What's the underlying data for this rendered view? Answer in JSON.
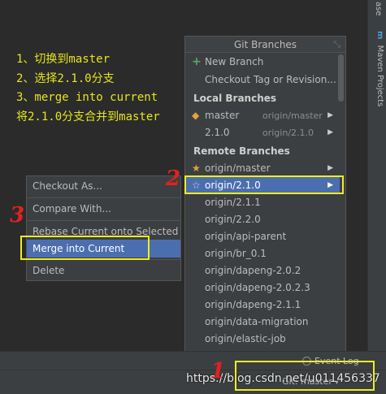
{
  "instructions": [
    "1、切换到master",
    "2、选择2.1.0分支",
    "3、merge into current",
    "将2.1.0分支合并到master"
  ],
  "right_strip": {
    "top_tab": "ase",
    "maven_tab": "Maven Projects",
    "maven_icon": "m"
  },
  "git_branches": {
    "title": "Git Branches",
    "new_branch": "New Branch",
    "checkout_tag": "Checkout Tag or Revision...",
    "local_header": "Local Branches",
    "local": [
      {
        "name": "master",
        "tracking": "origin/master"
      },
      {
        "name": "2.1.0",
        "tracking": "origin/2.1.0"
      }
    ],
    "remote_header": "Remote Branches",
    "remote": [
      "origin/master",
      "origin/2.1.0",
      "origin/2.1.1",
      "origin/2.2.0",
      "origin/api-parent",
      "origin/br_0.1",
      "origin/dapeng-2.0.2",
      "origin/dapeng-2.0.2.3",
      "origin/dapeng-2.1.1",
      "origin/data-migration",
      "origin/elastic-job"
    ],
    "selected_remote": "origin/2.1.0"
  },
  "context_menu": {
    "items": [
      "Checkout As...",
      "Compare With...",
      "Rebase Current onto Selected",
      "Merge into Current",
      "Delete"
    ],
    "selected": "Merge into Current"
  },
  "annotations": {
    "n1": "1",
    "n2": "2",
    "n3": "3",
    "color": "#f0ec20",
    "num_color": "#e0221e"
  },
  "statusbar": {
    "event_log": "Event Log",
    "git_branch": "Git: master",
    "watermark": "https://blog.csdn.net/u011456337"
  }
}
